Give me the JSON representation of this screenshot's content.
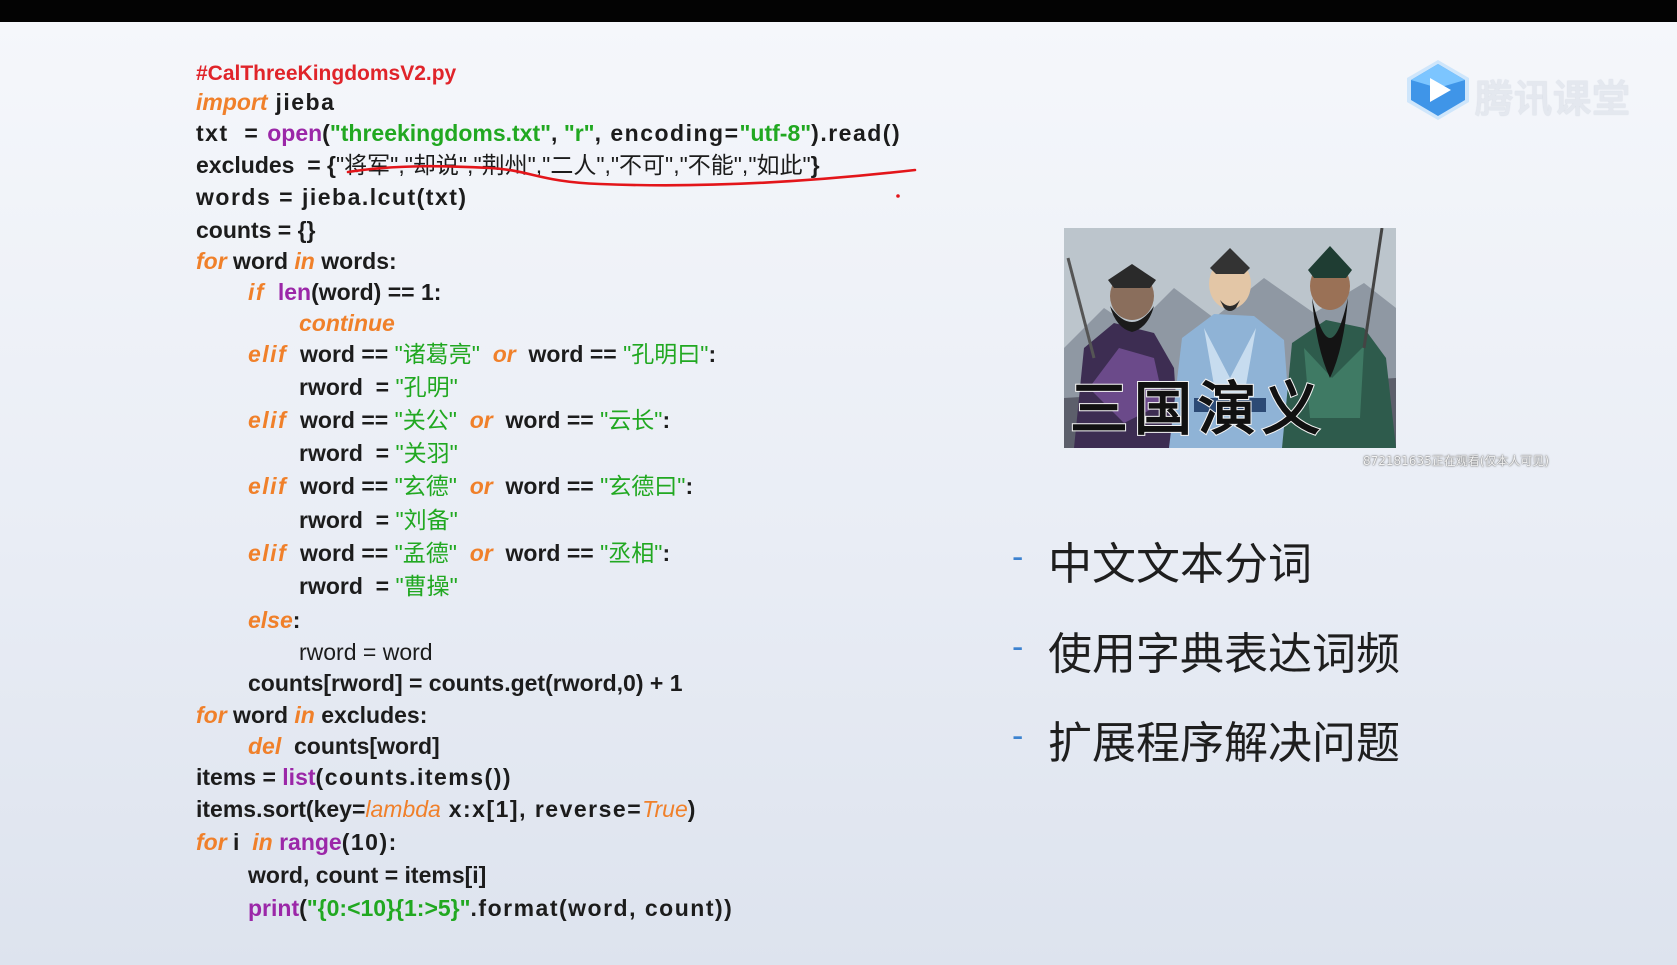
{
  "brand": {
    "name": "腾讯课堂",
    "icon": "play-icon",
    "colors": {
      "icon_blue": "#3a8ee6",
      "icon_light": "#8fd0ff"
    }
  },
  "code": {
    "colors": {
      "keyword": "#f0802a",
      "builtin": "#9b27a8",
      "string": "#21a821",
      "comment": "#e0242a",
      "text": "#1c1c1c"
    },
    "filename": "#CalThreeKingdomsV2.py",
    "l2": {
      "kw": "import",
      "rest": " jieba"
    },
    "l3": {
      "a": "txt  = ",
      "fn": "open",
      "b": "(",
      "s1": "\"threekingdoms.txt\"",
      "c": ", ",
      "s2": "\"r\"",
      "d": ", encoding=",
      "s3": "\"utf-8\"",
      "e": ").read()"
    },
    "l4": {
      "a": "excludes  = {",
      "b": "\"将军\",\"却说\",\"荆州\",\"二人\",\"不可\",\"不能\",\"如此\"",
      "c": "}"
    },
    "l5": {
      "a": "words = jieba.lcut(txt)"
    },
    "l6": {
      "a": "counts = {}"
    },
    "l7": {
      "kw1": "for",
      "a": " word ",
      "kw2": "in",
      "b": " words:"
    },
    "l8": {
      "kw": "if",
      "a": "  ",
      "fn": "len",
      "b": "(word) == 1:"
    },
    "l9": {
      "kw": "continue"
    },
    "l10": {
      "kw": "elif",
      "a": "  word == ",
      "s1": "\"诸葛亮\"",
      "kw2": "  or",
      "b": "  word == ",
      "s2": "\"孔明曰\"",
      "c": ":"
    },
    "l11": {
      "a": "rword  = ",
      "s": "\"孔明\""
    },
    "l12": {
      "kw": "elif",
      "a": "  word == ",
      "s1": "\"关公\"",
      "kw2": "  or",
      "b": "  word == ",
      "s2": "\"云长\"",
      "c": ":"
    },
    "l13": {
      "a": "rword  = ",
      "s": "\"关羽\""
    },
    "l14": {
      "kw": "elif",
      "a": "  word == ",
      "s1": "\"玄德\"",
      "kw2": "  or",
      "b": "  word == ",
      "s2": "\"玄德曰\"",
      "c": ":"
    },
    "l15": {
      "a": "rword  = ",
      "s": "\"刘备\""
    },
    "l16": {
      "kw": "elif",
      "a": "  word == ",
      "s1": "\"孟德\"",
      "kw2": "  or",
      "b": "  word == ",
      "s2": "\"丞相\"",
      "c": ":"
    },
    "l17": {
      "a": "rword  = ",
      "s": "\"曹操\""
    },
    "l18": {
      "kw": "else",
      "a": ":"
    },
    "l19": {
      "a": "rword = word"
    },
    "l20": {
      "a": "counts[rword] = counts.get(rword,0) + 1"
    },
    "l21": {
      "kw1": "for",
      "a": " word ",
      "kw2": "in",
      "b": " excludes:"
    },
    "l22": {
      "kw": "del",
      "a": "  counts[word]"
    },
    "l23": {
      "a": "items = ",
      "fn": "list",
      "b": "(counts.items())"
    },
    "l24": {
      "a": "items.sort(key=",
      "kw1": "lambda",
      "b": " x:x[1], reverse=",
      "kw2": "True",
      "c": ")"
    },
    "l25": {
      "kw1": "for",
      "a": " i  ",
      "kw2": "in",
      "b": " ",
      "fn": "range",
      "c": "(10):"
    },
    "l26": {
      "a": "word, count = items[i]"
    },
    "l27": {
      "fn": "print",
      "a": "(",
      "s": "\"{0:<10}{1:>5}\"",
      "b": ".format(word, count))"
    }
  },
  "picture": {
    "title": "三国演义",
    "watermark": "872181635正在观看(仅本人可见)"
  },
  "bullets": [
    {
      "dash": "-",
      "text": "中文文本分词"
    },
    {
      "dash": "-",
      "text": "使用字典表达词频"
    },
    {
      "dash": "-",
      "text": "扩展程序解决问题"
    }
  ]
}
